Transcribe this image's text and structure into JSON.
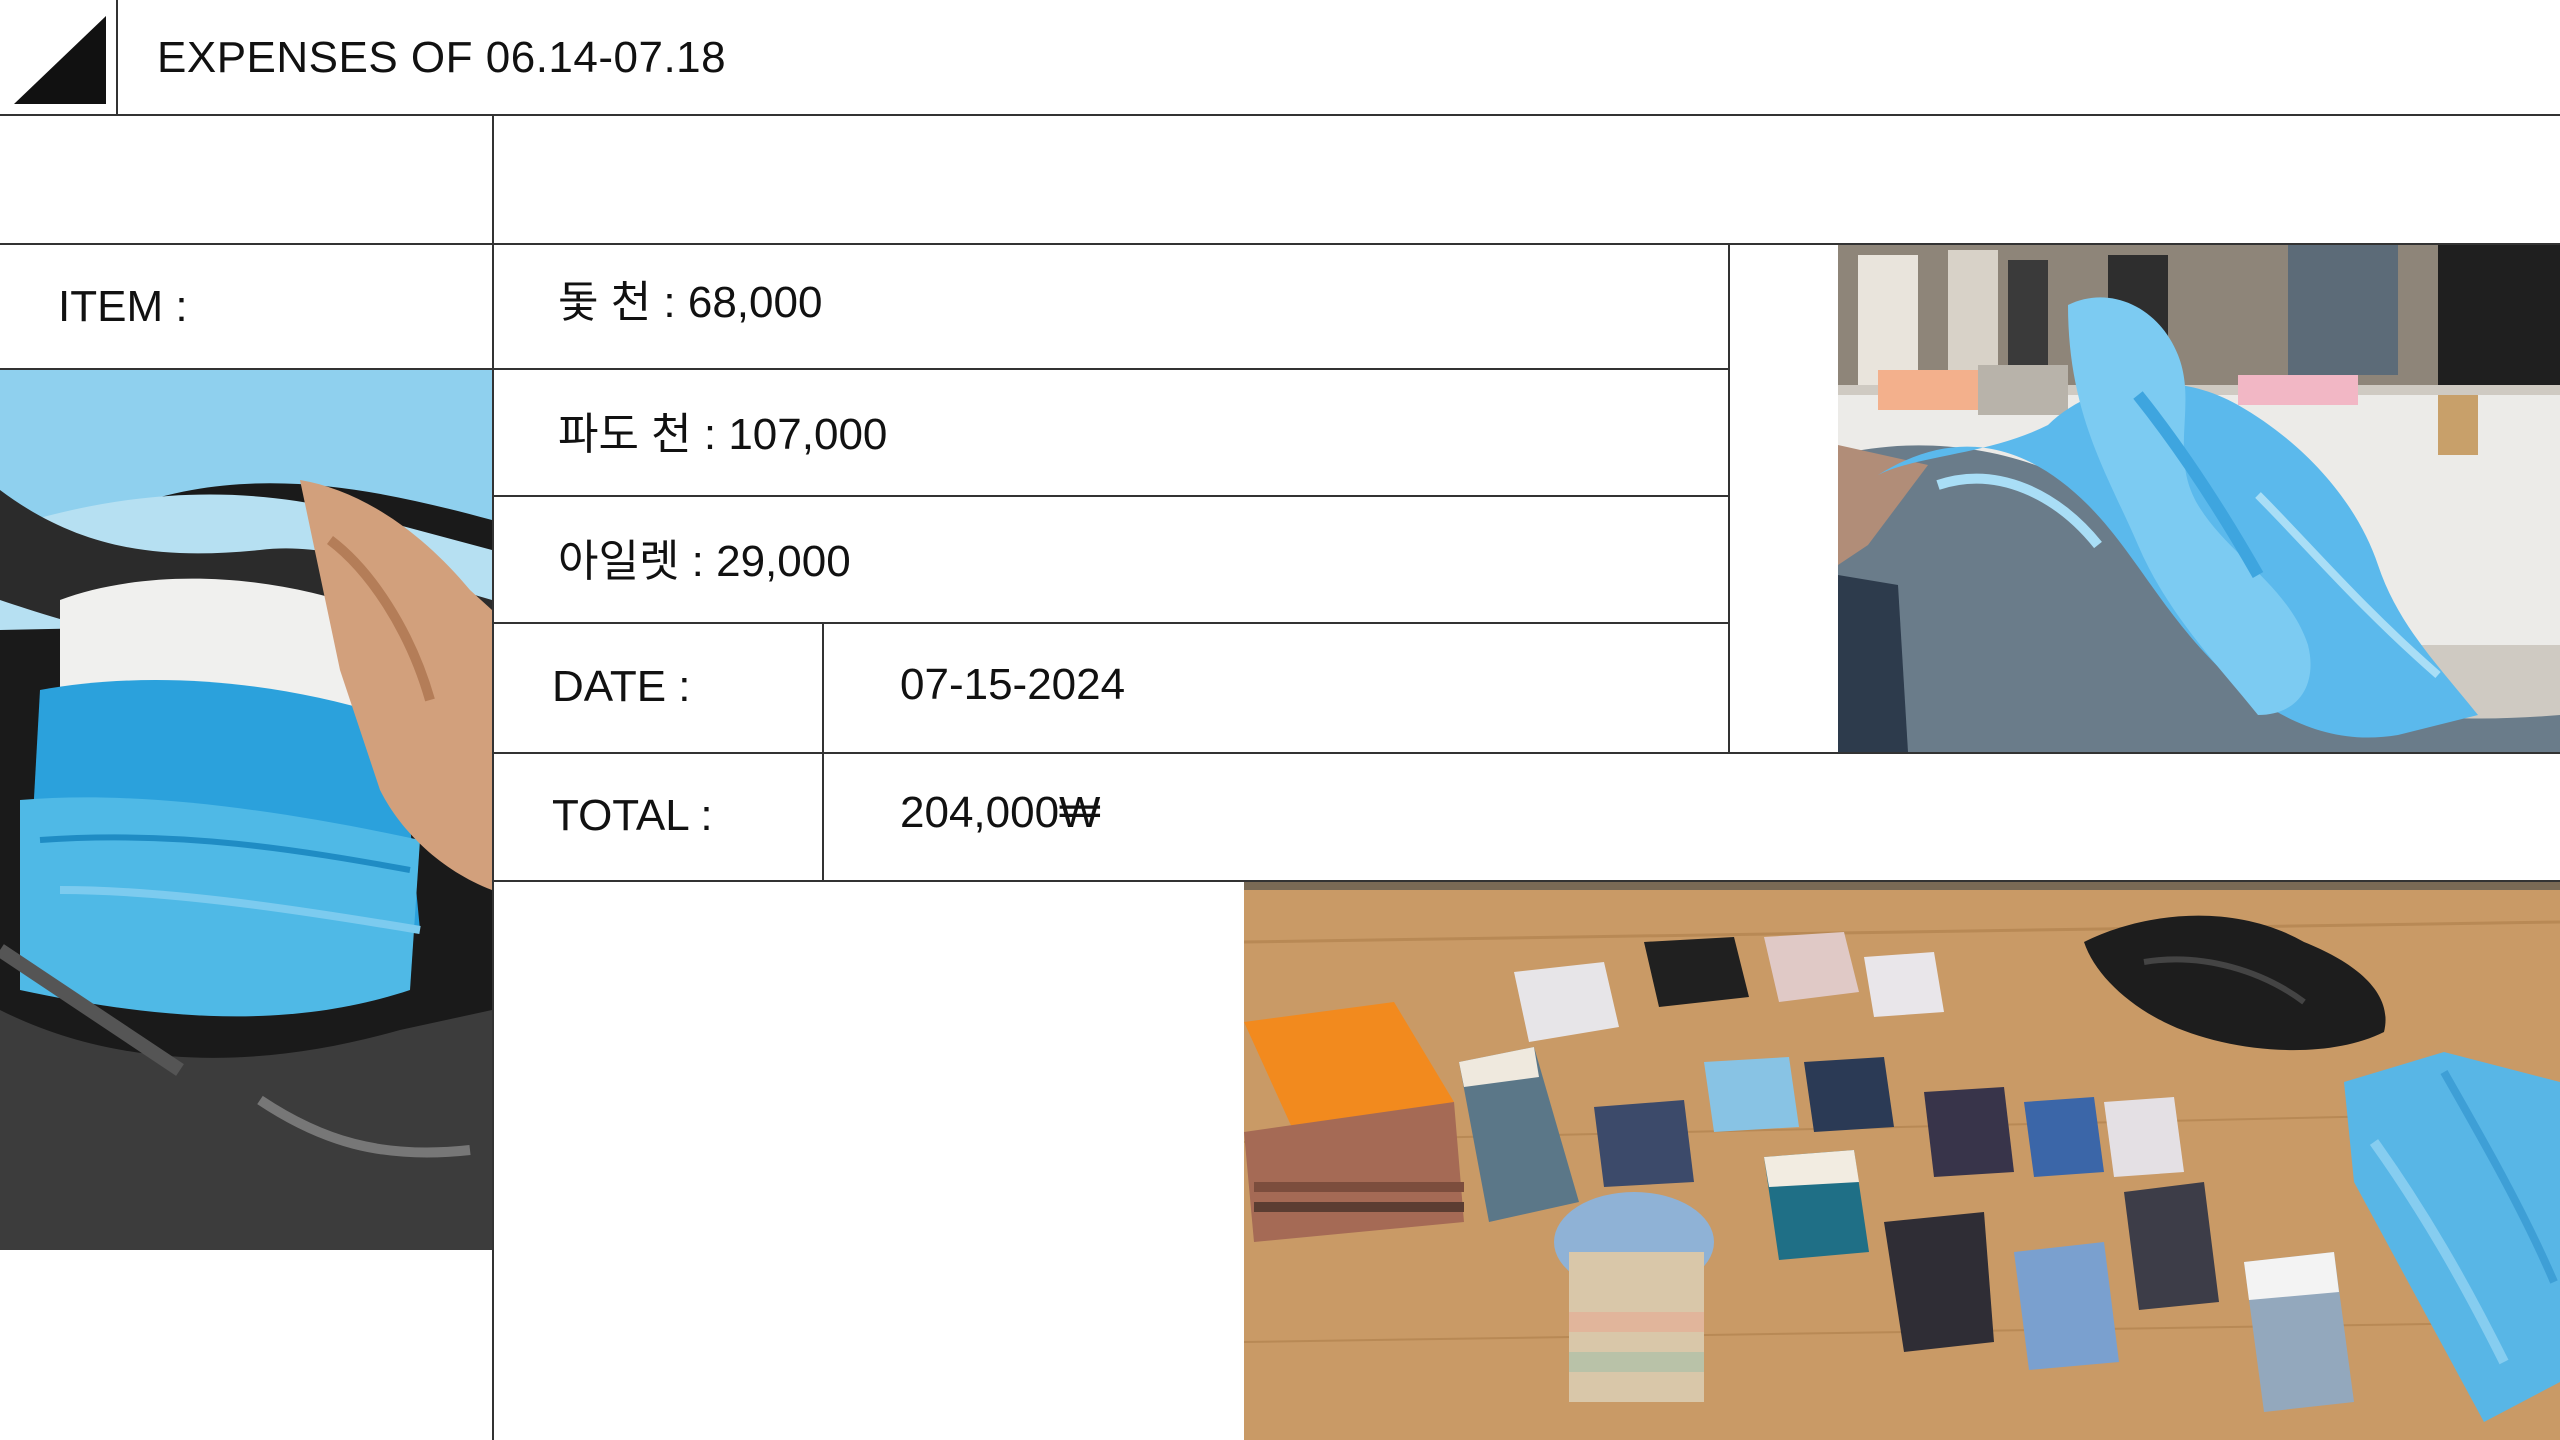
{
  "header": {
    "title": "EXPENSES OF 06.14-07.18"
  },
  "rows": {
    "item_label": "ITEM :",
    "items": [
      "돛 천 : 68,000",
      "파도 천 : 107,000",
      "아일렛 : 29,000"
    ],
    "date_label": "DATE :",
    "date_value": "07-15-2024",
    "total_label": "TOTAL :",
    "total_value": "204,000₩"
  },
  "images": {
    "left": {
      "description_icon": "blue-fabric-in-black-bag-photo"
    },
    "top_right": {
      "description_icon": "blue-organza-on-workshop-table-photo"
    },
    "bottom": {
      "description_icon": "fabric-swatches-on-wooden-table-photo"
    }
  },
  "colors": {
    "accent_blue": "#3aa9de",
    "wood": "#c99a66",
    "line": "#333333"
  }
}
